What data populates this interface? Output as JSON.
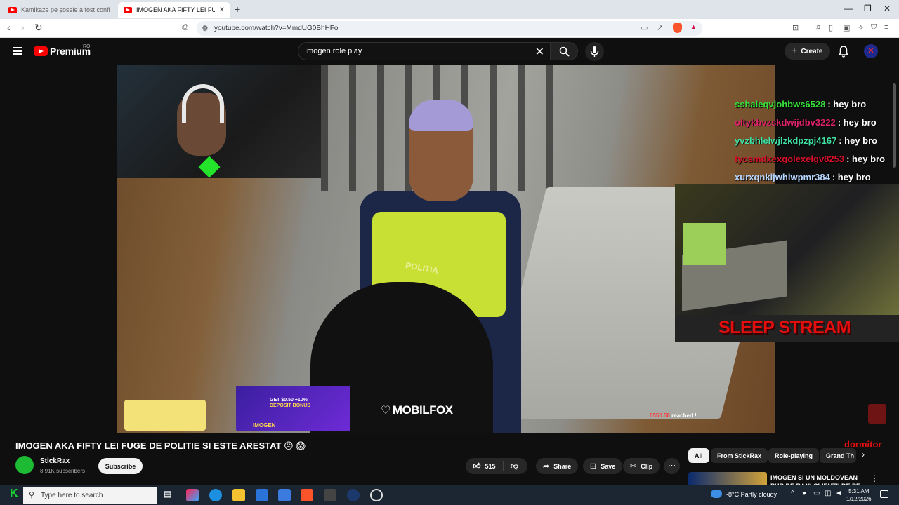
{
  "browser": {
    "tabs": [
      {
        "title": "Kamikaze pe șosele a fost confiscat"
      },
      {
        "title": "IMOGEN AKA FIFTY LEI FUGE"
      }
    ],
    "url": "youtube.com/watch?v=MmdUG0BhHFo"
  },
  "youtube": {
    "brand": "Premium",
    "region": "RO",
    "search_query": "Imogen role play",
    "create_label": "Create"
  },
  "overlay": {
    "chat": [
      {
        "user": "sshaleqvjohbws6528",
        "msg": ": hey bro",
        "color": "#35e33a"
      },
      {
        "user": "oltykbvzskdwijdbv3222",
        "msg": ": hey bro",
        "color": "#e0236a"
      },
      {
        "user": "yvzbhlelwjlzkdpzpj4167",
        "msg": ": hey bro",
        "color": "#3fe1a4"
      },
      {
        "user": "tycsmdxexgolexelgv8253",
        "msg": ": hey bro",
        "color": "#d8102a"
      },
      {
        "user": "xurxqnkijwhlwpmr384",
        "msg": ": hey bro",
        "color": "#b7d7ff"
      }
    ],
    "sleep_title": "SLEEP STREAM",
    "sponsor": "MOBILFOX",
    "ad_line1": "GET $0.50 +10%",
    "ad_line2": "DEPOSIT BONUS",
    "ad_brand": "IMOGEN",
    "goal_amount": "6550.50",
    "goal_text": "reached !",
    "vest_text": "POLITIA"
  },
  "video_info": {
    "title": "IMOGEN AKA FIFTY LEI FUGE DE POLITIE SI ESTE ARESTAT 😥 😱",
    "channel": "StickRax",
    "subscribers": "8.91K subscribers",
    "subscribe_label": "Subscribe",
    "likes": "515",
    "share_label": "Share",
    "save_label": "Save",
    "clip_label": "Clip"
  },
  "sidebar": {
    "chips": [
      "All",
      "From StickRax",
      "Role-playing",
      "Grand Th"
    ],
    "overlay_word": "dormitor",
    "recommended_title": "IMOGEN SI UN MOLDOVEAN PUR DE BANI CLIENTII DE PE"
  },
  "taskbar": {
    "search_placeholder": "Type here to search",
    "weather": "-8°C  Partly cloudy",
    "time": "5:31 AM",
    "date": "1/12/2026"
  }
}
